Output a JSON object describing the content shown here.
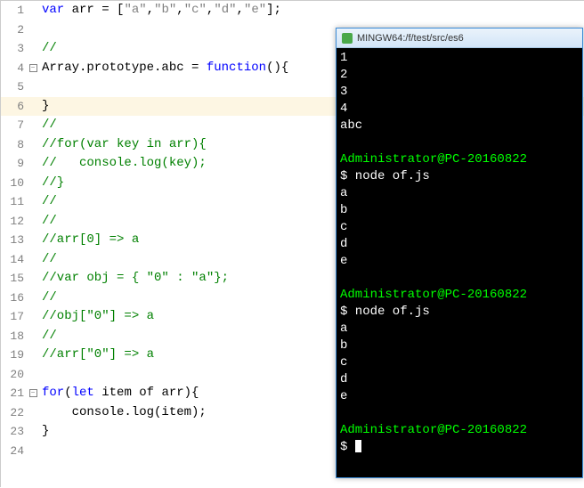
{
  "editor": {
    "lines": [
      {
        "n": "1",
        "fold": "",
        "segs": [
          {
            "c": "kw",
            "t": "var"
          },
          {
            "c": "",
            "t": " arr = ["
          },
          {
            "c": "str",
            "t": "\"a\""
          },
          {
            "c": "",
            "t": ","
          },
          {
            "c": "str",
            "t": "\"b\""
          },
          {
            "c": "",
            "t": ","
          },
          {
            "c": "str",
            "t": "\"c\""
          },
          {
            "c": "",
            "t": ","
          },
          {
            "c": "str",
            "t": "\"d\""
          },
          {
            "c": "",
            "t": ","
          },
          {
            "c": "str",
            "t": "\"e\""
          },
          {
            "c": "",
            "t": "];"
          }
        ]
      },
      {
        "n": "2",
        "fold": "",
        "segs": []
      },
      {
        "n": "3",
        "fold": "",
        "segs": [
          {
            "c": "cmt",
            "t": "//"
          }
        ]
      },
      {
        "n": "4",
        "fold": "minus",
        "segs": [
          {
            "c": "",
            "t": "Array.prototype.abc = "
          },
          {
            "c": "kw",
            "t": "function"
          },
          {
            "c": "",
            "t": "(){"
          }
        ]
      },
      {
        "n": "5",
        "fold": "",
        "segs": []
      },
      {
        "n": "6",
        "fold": "",
        "hl": true,
        "segs": [
          {
            "c": "",
            "t": "}"
          }
        ]
      },
      {
        "n": "7",
        "fold": "",
        "segs": [
          {
            "c": "cmt",
            "t": "//"
          }
        ]
      },
      {
        "n": "8",
        "fold": "",
        "segs": [
          {
            "c": "cmt",
            "t": "//for(var key in arr){"
          }
        ]
      },
      {
        "n": "9",
        "fold": "",
        "segs": [
          {
            "c": "cmt",
            "t": "//   console.log(key);"
          }
        ]
      },
      {
        "n": "10",
        "fold": "",
        "segs": [
          {
            "c": "cmt",
            "t": "//}"
          }
        ]
      },
      {
        "n": "11",
        "fold": "",
        "segs": [
          {
            "c": "cmt",
            "t": "//"
          }
        ]
      },
      {
        "n": "12",
        "fold": "",
        "segs": [
          {
            "c": "cmt",
            "t": "//"
          }
        ]
      },
      {
        "n": "13",
        "fold": "",
        "segs": [
          {
            "c": "cmt",
            "t": "//arr[0] => a"
          }
        ]
      },
      {
        "n": "14",
        "fold": "",
        "segs": [
          {
            "c": "cmt",
            "t": "//"
          }
        ]
      },
      {
        "n": "15",
        "fold": "",
        "segs": [
          {
            "c": "cmt",
            "t": "//var obj = { \"0\" : \"a\"};"
          }
        ]
      },
      {
        "n": "16",
        "fold": "",
        "segs": [
          {
            "c": "cmt",
            "t": "//"
          }
        ]
      },
      {
        "n": "17",
        "fold": "",
        "segs": [
          {
            "c": "cmt",
            "t": "//obj[\"0\"] => a"
          }
        ]
      },
      {
        "n": "18",
        "fold": "",
        "segs": [
          {
            "c": "cmt",
            "t": "//"
          }
        ]
      },
      {
        "n": "19",
        "fold": "",
        "segs": [
          {
            "c": "cmt",
            "t": "//arr[\"0\"] => a"
          }
        ]
      },
      {
        "n": "20",
        "fold": "",
        "segs": []
      },
      {
        "n": "21",
        "fold": "minus",
        "segs": [
          {
            "c": "kw",
            "t": "for"
          },
          {
            "c": "",
            "t": "("
          },
          {
            "c": "kw",
            "t": "let"
          },
          {
            "c": "",
            "t": " item of arr){"
          }
        ]
      },
      {
        "n": "22",
        "fold": "",
        "guide": true,
        "segs": [
          {
            "c": "",
            "t": "    console.log(item);"
          }
        ]
      },
      {
        "n": "23",
        "fold": "",
        "segs": [
          {
            "c": "",
            "t": "}"
          }
        ]
      },
      {
        "n": "24",
        "fold": "",
        "segs": []
      }
    ]
  },
  "terminal": {
    "title": "MINGW64:/f/test/src/es6",
    "lines": [
      {
        "cls": "out",
        "t": "1"
      },
      {
        "cls": "out",
        "t": "2"
      },
      {
        "cls": "out",
        "t": "3"
      },
      {
        "cls": "out",
        "t": "4"
      },
      {
        "cls": "out",
        "t": "abc"
      },
      {
        "cls": "",
        "t": ""
      },
      {
        "cls": "prompt",
        "t": "Administrator@PC-20160822"
      },
      {
        "cls": "out",
        "t": "$ node of.js"
      },
      {
        "cls": "out",
        "t": "a"
      },
      {
        "cls": "out",
        "t": "b"
      },
      {
        "cls": "out",
        "t": "c"
      },
      {
        "cls": "out",
        "t": "d"
      },
      {
        "cls": "out",
        "t": "e"
      },
      {
        "cls": "",
        "t": ""
      },
      {
        "cls": "prompt",
        "t": "Administrator@PC-20160822"
      },
      {
        "cls": "out",
        "t": "$ node of.js"
      },
      {
        "cls": "out",
        "t": "a"
      },
      {
        "cls": "out",
        "t": "b"
      },
      {
        "cls": "out",
        "t": "c"
      },
      {
        "cls": "out",
        "t": "d"
      },
      {
        "cls": "out",
        "t": "e"
      },
      {
        "cls": "",
        "t": ""
      },
      {
        "cls": "prompt",
        "t": "Administrator@PC-20160822"
      },
      {
        "cls": "out",
        "t": "$ ",
        "cursor": true
      }
    ]
  }
}
